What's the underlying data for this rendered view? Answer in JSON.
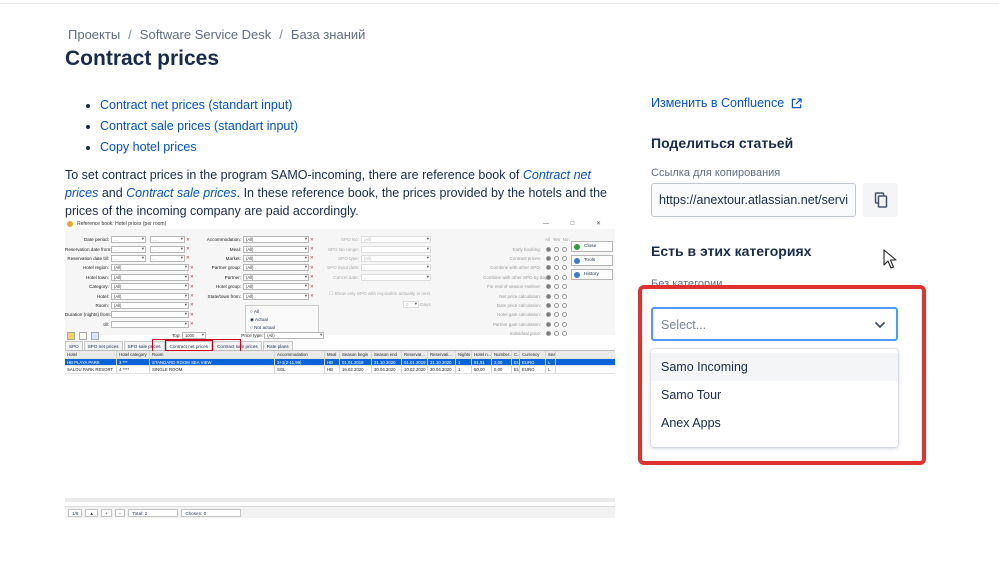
{
  "breadcrumb": {
    "items": [
      "Проекты",
      "Software Service Desk",
      "База знаний"
    ],
    "separator": "/"
  },
  "page_title": "Contract prices",
  "article": {
    "links": [
      "Contract net prices (standart input)",
      "Contract sale prices (standart input)",
      "Copy hotel prices"
    ],
    "intro": {
      "part1": "To set contract prices in the program SAMO-incoming, there are reference book of ",
      "link1": "Contract net prices",
      "part2": " and ",
      "link2": "Contract sale prices",
      "part3": ". In these reference book, the prices provided by the hotels and the prices of the incoming company are paid accordingly."
    }
  },
  "embedded_app": {
    "window_title": "Reference book: Hotel prices (per room)",
    "window_controls": "— □ ✕",
    "filters_left": [
      {
        "label": "Date period:",
        "value": ". .",
        "value2": ". ."
      },
      {
        "label": "Reservation date from:",
        "value": ". .",
        "value2": ". ."
      },
      {
        "label": "Reservation date till:",
        "value": ". .",
        "value2": ". ."
      },
      {
        "label": "Hotel region:",
        "value": "(All)"
      },
      {
        "label": "Hotel town:",
        "value": "(All)"
      },
      {
        "label": "Category:",
        "value": "(All)"
      },
      {
        "label": "Hotel:",
        "value": "(All)"
      },
      {
        "label": "Room:",
        "value": "(All)"
      },
      {
        "label": "Duration (nights) from:",
        "value": ""
      },
      {
        "label": "till:",
        "value": ""
      }
    ],
    "filters_mid": [
      {
        "label": "Accommodation:",
        "value": "(All)"
      },
      {
        "label": "Meal:",
        "value": "(All)"
      },
      {
        "label": "Market:",
        "value": "(All)"
      },
      {
        "label": "Partner group:",
        "value": "(All)"
      },
      {
        "label": "Partner:",
        "value": "(All)"
      },
      {
        "label": "Hotel group:",
        "value": "(All)"
      },
      {
        "label": "State/town from:",
        "value": "(All)"
      }
    ],
    "filters_right": [
      {
        "label": "SPO No:",
        "value": "(All)"
      },
      {
        "label": "SPO No range:",
        "value": ""
      },
      {
        "label": "SPO type:",
        "value": "(All)"
      },
      {
        "label": "SPO input date:",
        "value": ". ."
      },
      {
        "label": "Cancel date:",
        "value": ". ."
      }
    ],
    "spo_checkbox": "Show only SPO with expiration actuality in next",
    "days_value": "0",
    "days_label": "Days",
    "radio_options": [
      "All",
      "Actual",
      "Not actual"
    ],
    "flags_header": [
      "All",
      "Yes",
      "No"
    ],
    "flags": [
      "Early booking:",
      "Contract prices:",
      "Combine with other SPO:",
      "Combine with other SPO by day:",
      "For end of season Hotlexe:",
      "Net price calculation:",
      "Date price calculation:",
      "Hotel gain calculation:",
      "Partner gain calculation:",
      "Individual price:"
    ],
    "side_buttons": [
      "Close",
      "Tools",
      "History"
    ],
    "top_label": "Top:",
    "top_value": "1000",
    "price_type_label": "Price type:",
    "price_type_value": "(All)",
    "tabs": [
      "SPO",
      "SPO net prices",
      "SPO sale prices",
      "Contract net prices",
      "Contract sale prices",
      "Rate plans"
    ],
    "highlight_tab": "Contract net prices",
    "grid_headers": [
      "Hotel",
      "Hotel category",
      "Room",
      "Accommodation",
      "Meal",
      "Season begin",
      "Season end",
      "Reservat...",
      "Reservati...",
      "Nights",
      "Hotel n...",
      "Number...",
      "C...",
      "Currency",
      "Season"
    ],
    "grid_rows": [
      [
        "HB PLAYA PARK",
        "3 ***",
        "STANDARD ROOM SEA VIEW",
        "3+1(2-11,99)",
        "HB",
        "01.01.2019",
        "31.10.2020",
        "01.01.2019",
        "31.10.2020",
        "1",
        "91,91",
        "2,00",
        "EUR",
        "EURO",
        "L"
      ],
      [
        "SALOU PARK RESORT",
        "4 ****",
        "SINGLE ROOM",
        "SGL",
        "HB",
        "16.02.2020",
        "30.04.2020",
        "10.02.2020",
        "30.04.2020",
        "1",
        "50,00",
        "0,00",
        "EUR",
        "EURO",
        "L"
      ]
    ],
    "status_total": "Total: 2",
    "status_chosen": "Chosen: 0",
    "status_page": "1/6"
  },
  "sidebar": {
    "edit_link": "Изменить в Confluence",
    "share_title": "Поделиться статьей",
    "copy_label": "Ссылка для копирования",
    "copy_value": "https://anextour.atlassian.net/servicedesk/customer/kb/view/",
    "categories_title": "Есть в этих категориях",
    "no_category": "Без категории",
    "select_placeholder": "Select...",
    "options": [
      "Samo Incoming",
      "Samo Tour",
      "Anex Apps"
    ],
    "focused_option": "Samo Incoming"
  },
  "colors": {
    "link": "#0052cc",
    "text": "#172b4d",
    "muted": "#5e6c84",
    "focus": "#4c9aff",
    "highlight_frame": "#e03131"
  }
}
